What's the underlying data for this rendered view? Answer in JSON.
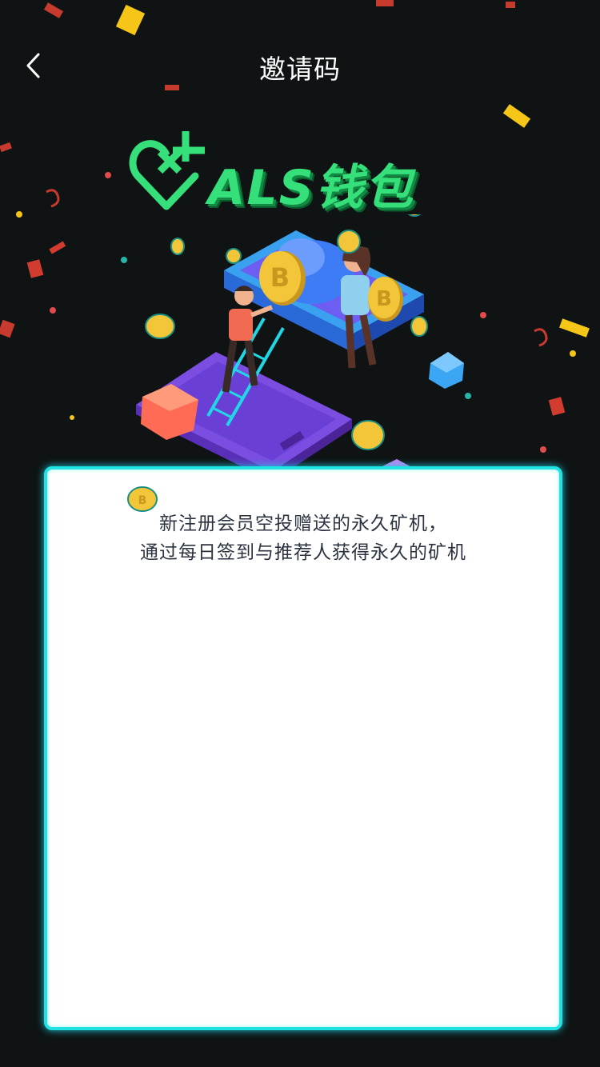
{
  "header": {
    "title": "邀请码",
    "back_icon": "chevron-left-icon"
  },
  "logo": {
    "text": "ALS钱包",
    "icon": "heart-plus-icon",
    "color": "#35e07a"
  },
  "illustration": {
    "name": "crypto-mining-illustration"
  },
  "card": {
    "line1": "新注册会员空投赠送的永久矿机，",
    "line2": "通过每日签到与推荐人获得永久的矿机",
    "border_color": "#22e3e3"
  },
  "colors": {
    "background": "#0f1314",
    "accent": "#22e3e3",
    "coin": "#f3c63a"
  }
}
